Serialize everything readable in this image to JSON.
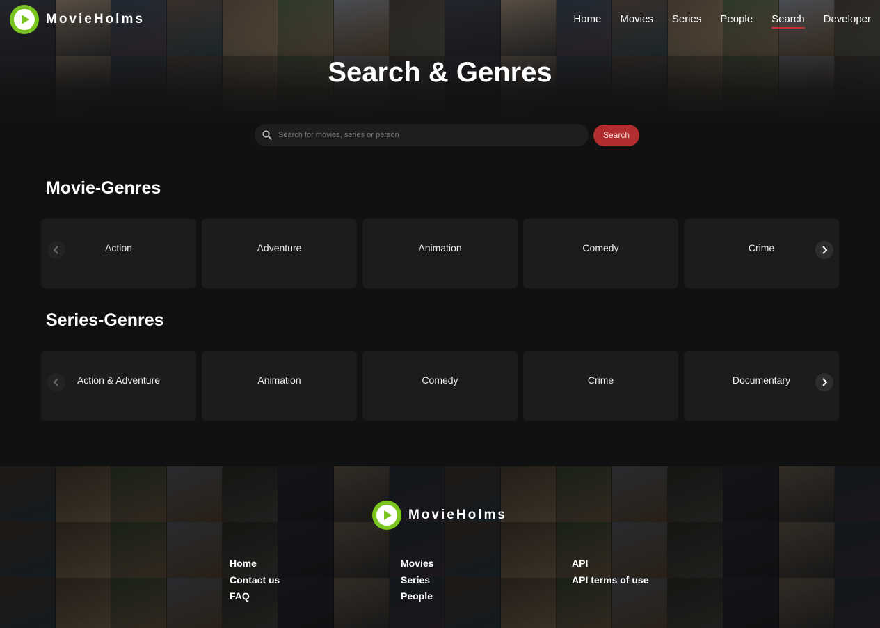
{
  "brand": {
    "name": "MovieHolms",
    "accent": "#7ac51f"
  },
  "nav": {
    "links": [
      {
        "label": "Home"
      },
      {
        "label": "Movies"
      },
      {
        "label": "Series"
      },
      {
        "label": "People"
      },
      {
        "label": "Search",
        "active": true
      },
      {
        "label": "Developer"
      }
    ],
    "active_underline_color": "#c23535"
  },
  "page": {
    "title": "Search & Genres"
  },
  "search": {
    "placeholder": "Search for movies, series or person",
    "value": "",
    "button_label": "Search",
    "button_color": "#b22e2e"
  },
  "movie_genres": {
    "title": "Movie-Genres",
    "items": [
      "Action",
      "Adventure",
      "Animation",
      "Comedy",
      "Crime"
    ]
  },
  "series_genres": {
    "title": "Series-Genres",
    "items": [
      "Action & Adventure",
      "Animation",
      "Comedy",
      "Crime",
      "Documentary"
    ]
  },
  "footer": {
    "columns": [
      [
        "Home",
        "Contact us",
        "FAQ"
      ],
      [
        "Movies",
        "Series",
        "People"
      ],
      [
        "API",
        "API terms of use"
      ]
    ]
  },
  "icons": {
    "logo": "play-circle-icon",
    "search": "magnifier-icon",
    "prev": "chevron-left-icon",
    "next": "chevron-right-icon"
  }
}
